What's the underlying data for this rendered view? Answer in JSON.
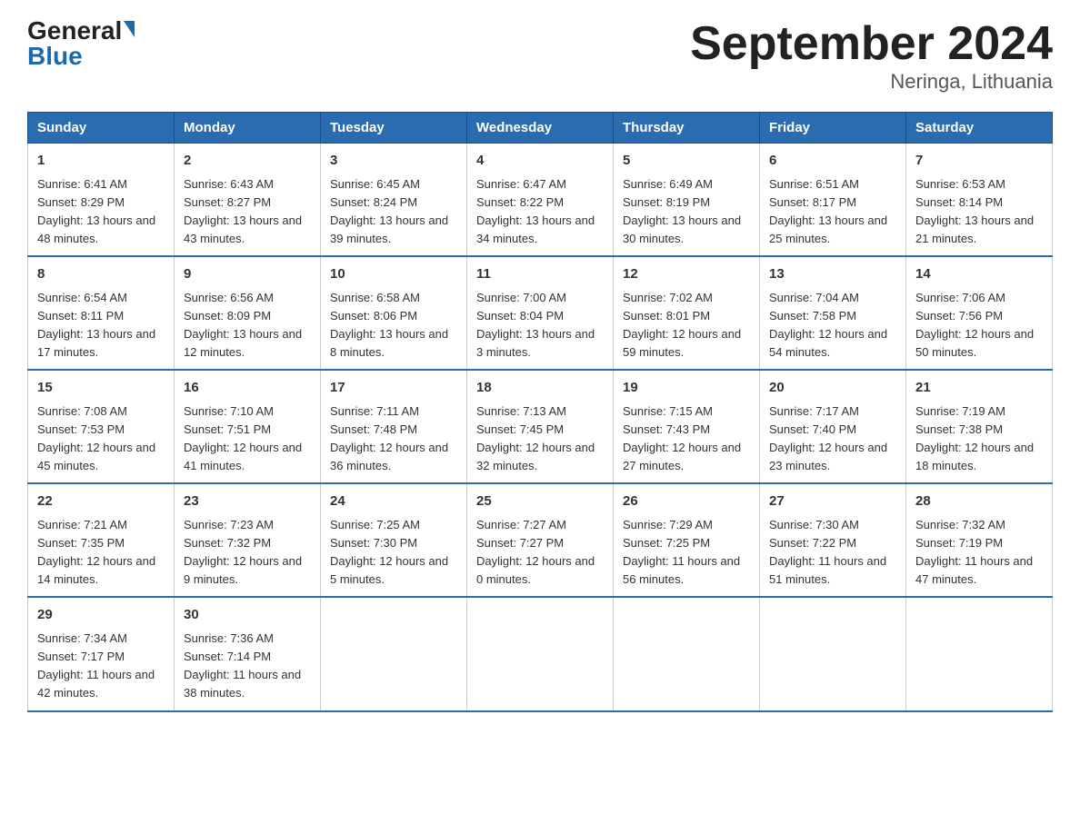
{
  "header": {
    "logo_general": "General",
    "logo_blue": "Blue",
    "title": "September 2024",
    "subtitle": "Neringa, Lithuania"
  },
  "weekdays": [
    "Sunday",
    "Monday",
    "Tuesday",
    "Wednesday",
    "Thursday",
    "Friday",
    "Saturday"
  ],
  "weeks": [
    [
      {
        "day": "1",
        "sunrise": "6:41 AM",
        "sunset": "8:29 PM",
        "daylight": "13 hours and 48 minutes."
      },
      {
        "day": "2",
        "sunrise": "6:43 AM",
        "sunset": "8:27 PM",
        "daylight": "13 hours and 43 minutes."
      },
      {
        "day": "3",
        "sunrise": "6:45 AM",
        "sunset": "8:24 PM",
        "daylight": "13 hours and 39 minutes."
      },
      {
        "day": "4",
        "sunrise": "6:47 AM",
        "sunset": "8:22 PM",
        "daylight": "13 hours and 34 minutes."
      },
      {
        "day": "5",
        "sunrise": "6:49 AM",
        "sunset": "8:19 PM",
        "daylight": "13 hours and 30 minutes."
      },
      {
        "day": "6",
        "sunrise": "6:51 AM",
        "sunset": "8:17 PM",
        "daylight": "13 hours and 25 minutes."
      },
      {
        "day": "7",
        "sunrise": "6:53 AM",
        "sunset": "8:14 PM",
        "daylight": "13 hours and 21 minutes."
      }
    ],
    [
      {
        "day": "8",
        "sunrise": "6:54 AM",
        "sunset": "8:11 PM",
        "daylight": "13 hours and 17 minutes."
      },
      {
        "day": "9",
        "sunrise": "6:56 AM",
        "sunset": "8:09 PM",
        "daylight": "13 hours and 12 minutes."
      },
      {
        "day": "10",
        "sunrise": "6:58 AM",
        "sunset": "8:06 PM",
        "daylight": "13 hours and 8 minutes."
      },
      {
        "day": "11",
        "sunrise": "7:00 AM",
        "sunset": "8:04 PM",
        "daylight": "13 hours and 3 minutes."
      },
      {
        "day": "12",
        "sunrise": "7:02 AM",
        "sunset": "8:01 PM",
        "daylight": "12 hours and 59 minutes."
      },
      {
        "day": "13",
        "sunrise": "7:04 AM",
        "sunset": "7:58 PM",
        "daylight": "12 hours and 54 minutes."
      },
      {
        "day": "14",
        "sunrise": "7:06 AM",
        "sunset": "7:56 PM",
        "daylight": "12 hours and 50 minutes."
      }
    ],
    [
      {
        "day": "15",
        "sunrise": "7:08 AM",
        "sunset": "7:53 PM",
        "daylight": "12 hours and 45 minutes."
      },
      {
        "day": "16",
        "sunrise": "7:10 AM",
        "sunset": "7:51 PM",
        "daylight": "12 hours and 41 minutes."
      },
      {
        "day": "17",
        "sunrise": "7:11 AM",
        "sunset": "7:48 PM",
        "daylight": "12 hours and 36 minutes."
      },
      {
        "day": "18",
        "sunrise": "7:13 AM",
        "sunset": "7:45 PM",
        "daylight": "12 hours and 32 minutes."
      },
      {
        "day": "19",
        "sunrise": "7:15 AM",
        "sunset": "7:43 PM",
        "daylight": "12 hours and 27 minutes."
      },
      {
        "day": "20",
        "sunrise": "7:17 AM",
        "sunset": "7:40 PM",
        "daylight": "12 hours and 23 minutes."
      },
      {
        "day": "21",
        "sunrise": "7:19 AM",
        "sunset": "7:38 PM",
        "daylight": "12 hours and 18 minutes."
      }
    ],
    [
      {
        "day": "22",
        "sunrise": "7:21 AM",
        "sunset": "7:35 PM",
        "daylight": "12 hours and 14 minutes."
      },
      {
        "day": "23",
        "sunrise": "7:23 AM",
        "sunset": "7:32 PM",
        "daylight": "12 hours and 9 minutes."
      },
      {
        "day": "24",
        "sunrise": "7:25 AM",
        "sunset": "7:30 PM",
        "daylight": "12 hours and 5 minutes."
      },
      {
        "day": "25",
        "sunrise": "7:27 AM",
        "sunset": "7:27 PM",
        "daylight": "12 hours and 0 minutes."
      },
      {
        "day": "26",
        "sunrise": "7:29 AM",
        "sunset": "7:25 PM",
        "daylight": "11 hours and 56 minutes."
      },
      {
        "day": "27",
        "sunrise": "7:30 AM",
        "sunset": "7:22 PM",
        "daylight": "11 hours and 51 minutes."
      },
      {
        "day": "28",
        "sunrise": "7:32 AM",
        "sunset": "7:19 PM",
        "daylight": "11 hours and 47 minutes."
      }
    ],
    [
      {
        "day": "29",
        "sunrise": "7:34 AM",
        "sunset": "7:17 PM",
        "daylight": "11 hours and 42 minutes."
      },
      {
        "day": "30",
        "sunrise": "7:36 AM",
        "sunset": "7:14 PM",
        "daylight": "11 hours and 38 minutes."
      },
      null,
      null,
      null,
      null,
      null
    ]
  ]
}
